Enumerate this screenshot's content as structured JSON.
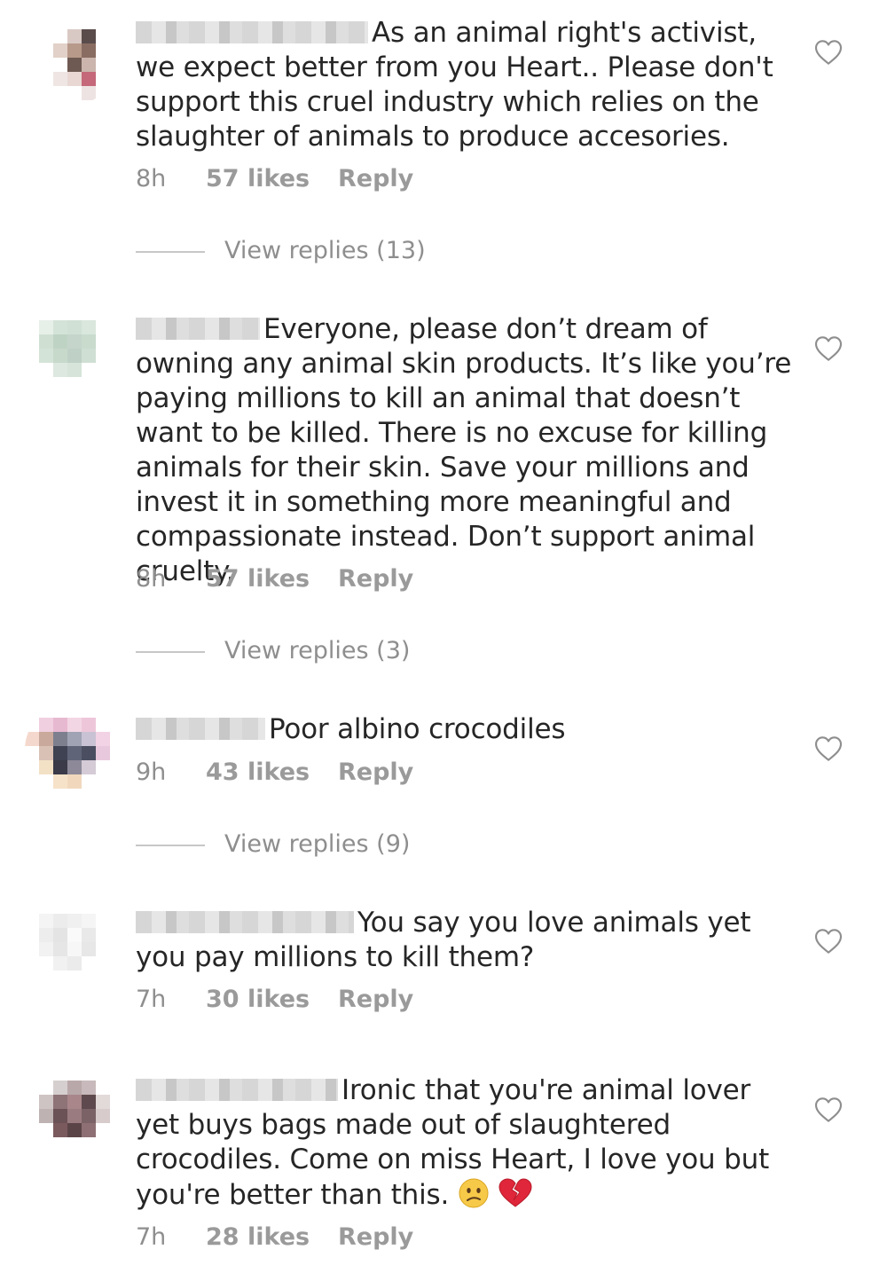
{
  "comments": [
    {
      "text": "As an animal right's activist, we expect better from you Heart.. Please don't support this cruel industry which relies on the slaughter of animals to produce accesories.",
      "time": "8h",
      "likes": "57 likes",
      "reply": "Reply",
      "view_replies": "View replies (13)",
      "like_icon": "heart-outline-icon"
    },
    {
      "text": "Everyone, please don’t dream of owning any animal skin products. It’s like you’re paying millions to kill an animal that doesn’t want to be killed. There is no excuse for killing animals for their skin. Save your millions and invest it in something more meaningful and compassionate instead. Don’t support animal cruelty.",
      "time": "8h",
      "likes": "57 likes",
      "reply": "Reply",
      "view_replies": "View replies (3)",
      "like_icon": "heart-outline-icon"
    },
    {
      "text": "Poor albino crocodiles",
      "time": "9h",
      "likes": "43 likes",
      "reply": "Reply",
      "view_replies": "View replies (9)",
      "like_icon": "heart-outline-icon"
    },
    {
      "text": "You say you love animals yet you pay millions to kill them?",
      "time": "7h",
      "likes": "30 likes",
      "reply": "Reply",
      "like_icon": "heart-outline-icon"
    },
    {
      "text": "Ironic that you're animal lover yet buys bags made out of slaughtered crocodiles. Come on miss Heart, I love you but you're better than this.",
      "emojis": [
        "confused-face-emoji",
        "broken-heart-emoji"
      ],
      "time": "7h",
      "likes": "28 likes",
      "reply": "Reply",
      "like_icon": "heart-outline-icon"
    }
  ],
  "colors": {
    "text": "#262626",
    "meta": "#8e8e8e",
    "divider": "#c7c7c7",
    "background": "#ffffff"
  }
}
